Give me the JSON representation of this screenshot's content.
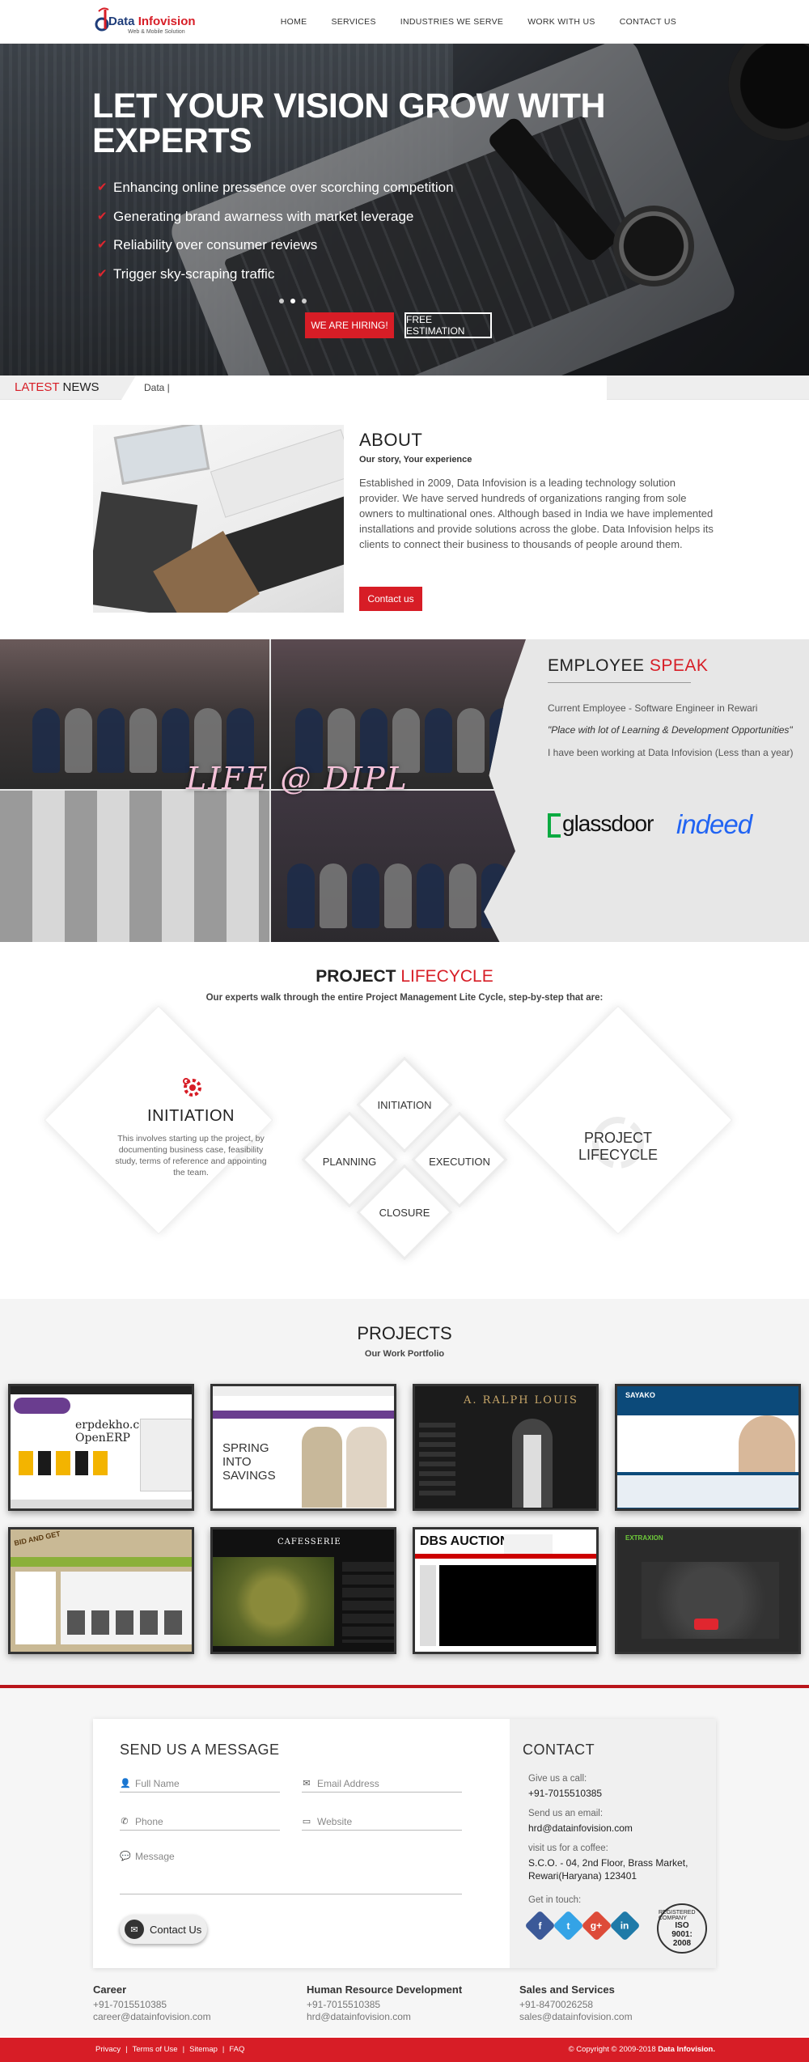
{
  "brand": {
    "name_a": "Data",
    "name_b": "Infovision",
    "tagline": "Web & Mobile Solution",
    "accent": "#d71d26",
    "navy": "#1f3d7a"
  },
  "nav": [
    "HOME",
    "SERVICES",
    "INDUSTRIES WE SERVE",
    "WORK WITH US",
    "CONTACT US"
  ],
  "hero": {
    "title": "LET YOUR VISION GROW WITH EXPERTS",
    "points": [
      "Enhancing online pressence over scorching competition",
      "Generating brand awarness with market leverage",
      "Reliability over consumer reviews",
      "Trigger sky-scraping traffic"
    ],
    "slide_count": 3,
    "active_slide": 2,
    "btn_hiring": "WE ARE HIRING!",
    "btn_estimate": "FREE ESTIMATION"
  },
  "news": {
    "label_a": "LATEST",
    "label_b": "NEWS",
    "ticker": "Data |"
  },
  "about": {
    "title": "ABOUT",
    "subtitle": "Our story, Your experience",
    "text": "Established in 2009, Data Infovision is a leading technology solution provider. We have served hundreds of organizations ranging from sole owners to multinational ones. Although based in India we have implemented installations and provide solutions across the globe. Data Infovision helps its clients to connect their business to thousands of people around them.",
    "button": "Contact us"
  },
  "life": {
    "title": "LIFE @ DIPL",
    "emp_a": "EMPLOYEE",
    "emp_b": "SPEAK",
    "line1": "Current Employee - Software Engineer in Rewari",
    "line2": "\"Place with lot of Learning & Development Opportunities\"",
    "line3": "I have been working at Data Infovision (Less than a year)",
    "glassdoor": "glassdoor",
    "indeed": "indeed"
  },
  "lifecycle": {
    "title_a": "PROJECT",
    "title_b": "LIFECYCLE",
    "subtitle": "Our experts walk through the entire Project Management Lite Cycle, step-by-step that are:",
    "active_title": "INITIATION",
    "active_text": "This involves starting up the project, by documenting business case, feasibility study, terms of reference and appointing the team.",
    "steps": {
      "top": "INITIATION",
      "left": "PLANNING",
      "right": "EXECUTION",
      "bottom": "CLOSURE"
    },
    "center_label": "PROJECT LIFECYCLE"
  },
  "projects": {
    "title": "PROJECTS",
    "subtitle": "Our Work Portfolio",
    "items": [
      {
        "label": "erpdekho.com OpenERP",
        "theme": "#ffffff"
      },
      {
        "label": "SPRING INTO SAVINGS",
        "theme": "#ffffff"
      },
      {
        "label": "A. RALPH LOUIS",
        "theme": "#1b1b1b"
      },
      {
        "label": "SAYAKO",
        "theme": "#0c4a7a"
      },
      {
        "label": "BID AND GET",
        "theme": "#c9b995"
      },
      {
        "label": "CAFESSERIE",
        "theme": "#111111"
      },
      {
        "label": "DBS AUCTION",
        "theme": "#ffffff"
      },
      {
        "label": "EXTRAXION",
        "theme": "#2b2b2b"
      }
    ]
  },
  "contact": {
    "form_title": "SEND US A MESSAGE",
    "ph_name": "Full Name",
    "ph_email": "Email Address",
    "ph_phone": "Phone",
    "ph_website": "Website",
    "ph_message": "Message",
    "send": "Contact Us",
    "title": "CONTACT",
    "call_label": "Give us a call:",
    "call_value": "+91-7015510385",
    "email_label": "Send us an email:",
    "email_value": "hrd@datainfovision.com",
    "coffee_label": "visit us for a coffee:",
    "coffee_value": "S.C.O. - 04, 2nd Floor, Brass Market, Rewari(Haryana) 123401",
    "touch_label": "Get in touch:",
    "iso_a": "ISO",
    "iso_b": "9001:",
    "iso_c": "2008",
    "iso_ring": "REGISTERED COMPANY"
  },
  "footer_cols": [
    {
      "head": "Career",
      "phone": "+91-7015510385",
      "email": "career@datainfovision.com"
    },
    {
      "head": "Human Resource Development",
      "phone": "+91-7015510385",
      "email": "hrd@datainfovision.com"
    },
    {
      "head": "Sales and Services",
      "phone": "+91-8470026258",
      "email": "sales@datainfovision.com"
    }
  ],
  "footer": {
    "links": [
      "Privacy",
      "Terms of Use",
      "Sitemap",
      "FAQ"
    ],
    "copy_a": "© Copyright © 2009-2018",
    "copy_b": "Data Infovision."
  }
}
